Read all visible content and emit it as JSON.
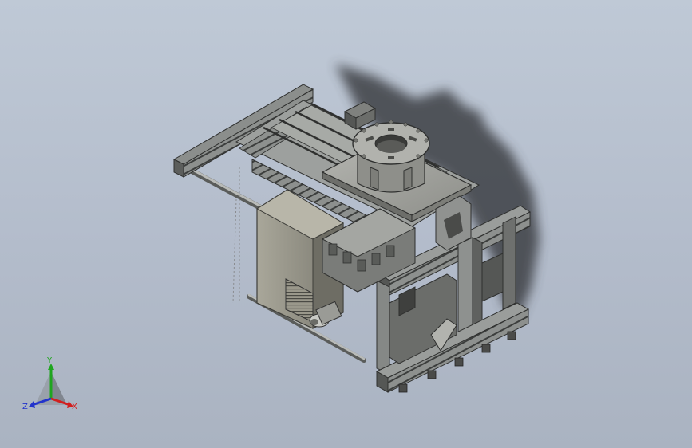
{
  "viewport": {
    "background_top": "#bfc9d6",
    "background_bottom": "#aab3c1"
  },
  "model": {
    "description_icon": "cad-assembly-model",
    "colors": {
      "profile": "#8b8e8c",
      "profile_dark": "#3c3e3d",
      "plate": "#a7a8a3",
      "housing": "#9a988b",
      "shadow": "#3e3f44"
    }
  },
  "triad": {
    "x_label": "X",
    "y_label": "Y",
    "z_label": "Z",
    "x_color": "#d21f1f",
    "y_color": "#1fa51f",
    "z_color": "#2233cc"
  }
}
